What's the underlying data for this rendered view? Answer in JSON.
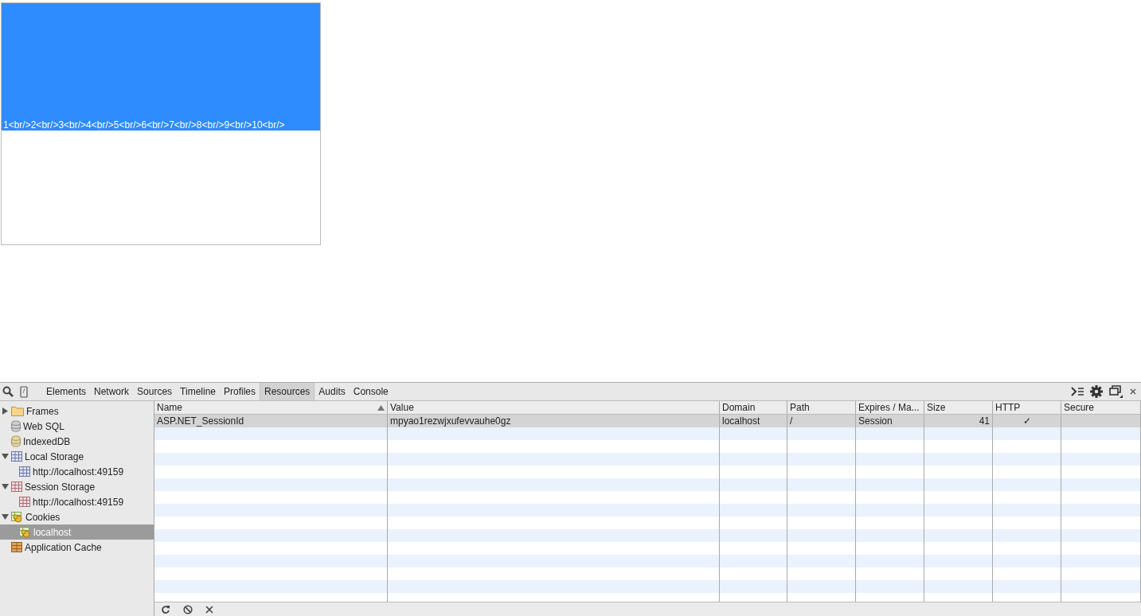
{
  "page": {
    "box_text": "1<br/>2<br/>3<br/>4<br/>5<br/>6<br/>7<br/>8<br/>9<br/>10<br/>"
  },
  "devtools": {
    "tabs": [
      {
        "label": "Elements",
        "selected": false
      },
      {
        "label": "Network",
        "selected": false
      },
      {
        "label": "Sources",
        "selected": false
      },
      {
        "label": "Timeline",
        "selected": false
      },
      {
        "label": "Profiles",
        "selected": false
      },
      {
        "label": "Resources",
        "selected": true
      },
      {
        "label": "Audits",
        "selected": false
      },
      {
        "label": "Console",
        "selected": false
      }
    ],
    "sidebar": {
      "items": [
        {
          "label": "Frames",
          "kind": "folder",
          "expanded": false,
          "selected": false
        },
        {
          "label": "Web SQL",
          "kind": "database",
          "selected": false
        },
        {
          "label": "IndexedDB",
          "kind": "indexeddb",
          "selected": false
        },
        {
          "label": "Local Storage",
          "kind": "local",
          "expanded": true,
          "selected": false,
          "children": [
            {
              "label": "http://localhost:49159",
              "kind": "local",
              "selected": false
            }
          ]
        },
        {
          "label": "Session Storage",
          "kind": "session",
          "expanded": true,
          "selected": false,
          "children": [
            {
              "label": "http://localhost:49159",
              "kind": "session",
              "selected": false
            }
          ]
        },
        {
          "label": "Cookies",
          "kind": "cookie",
          "expanded": true,
          "selected": false,
          "children": [
            {
              "label": "localhost",
              "kind": "cookie",
              "selected": true
            }
          ]
        },
        {
          "label": "Application Cache",
          "kind": "cache",
          "selected": false
        }
      ]
    },
    "table": {
      "columns": [
        {
          "label": "Name",
          "sorted": true
        },
        {
          "label": "Value",
          "sorted": false
        },
        {
          "label": "Domain",
          "sorted": false
        },
        {
          "label": "Path",
          "sorted": false
        },
        {
          "label": "Expires / Ma...",
          "sorted": false
        },
        {
          "label": "Size",
          "sorted": false
        },
        {
          "label": "HTTP",
          "sorted": false
        },
        {
          "label": "Secure",
          "sorted": false
        }
      ],
      "rows": [
        {
          "selected": true,
          "cells": [
            "ASP.NET_SessionId",
            "mpyao1rezwjxufevvauhe0gz",
            "localhost",
            "/",
            "Session",
            "41",
            "✓",
            ""
          ]
        }
      ]
    }
  }
}
